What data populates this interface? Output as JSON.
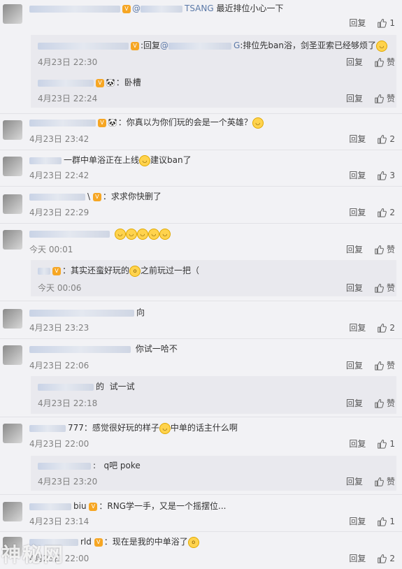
{
  "labels": {
    "reply": "回复",
    "like": "赞"
  },
  "watermark": "神秘网",
  "comments": [
    {
      "id": "c1",
      "text_mention": "@",
      "mention_suffix": "TSANG",
      "text": "最近排位小心一下",
      "time": "",
      "likes": "1"
    },
    {
      "id": "r1",
      "name_suffix": "",
      "text_prefix": ":回复",
      "mention": "@",
      "mention_suffix": "G",
      "text": ":排位先ban浴，剑圣亚索已经够烦了",
      "time": "4月23日 22:30",
      "likes": "赞"
    },
    {
      "id": "r2",
      "text": "：卧槽",
      "time": "4月23日 22:24",
      "likes": "赞"
    },
    {
      "id": "c2",
      "text": "：你真以为你们玩的会是一个英雄？",
      "time": "4月23日 23:42",
      "likes": "2"
    },
    {
      "id": "c3",
      "text_a": "一群中单浴正在上线",
      "text_b": "建议ban了",
      "time": "4月23日 22:42",
      "likes": "3"
    },
    {
      "id": "c4",
      "name_suffix": "\\",
      "text": "：求求你快删了",
      "time": "4月23日 22:29",
      "likes": "2"
    },
    {
      "id": "c5",
      "text": "",
      "time": "今天 00:01",
      "likes": "赞"
    },
    {
      "id": "r3",
      "name_suffix": "浪 9",
      "text_a": "：其实还蛮好玩的",
      "text_b": "之前玩过一把（",
      "time": "今天 00:06",
      "likes": "赞"
    },
    {
      "id": "c6",
      "name_suffix": "向",
      "text": "",
      "time": "4月23日 23:23",
      "likes": "2"
    },
    {
      "id": "c7",
      "text": "你试一哈不",
      "time": "4月23日 22:06",
      "likes": "赞"
    },
    {
      "id": "r4",
      "name_suffix": "的",
      "text": "试一试",
      "time": "4月23日 22:18",
      "likes": "赞"
    },
    {
      "id": "c8",
      "name_suffix": "777",
      "text_a": "：感觉很好玩的样子",
      "text_b": "中单的话主什么啊",
      "time": "4月23日 22:00",
      "likes": "1"
    },
    {
      "id": "r5",
      "name_suffix": ":",
      "text": "q吧  poke",
      "time": "4月23日 23:20",
      "likes": "赞"
    },
    {
      "id": "c9",
      "name_suffix": "biu",
      "text": "：RNG学一手，又是一个摇摆位...",
      "time": "4月23日 23:14",
      "likes": "1"
    },
    {
      "id": "c10",
      "name_suffix": "rld",
      "text_a": "：现在是我的中单浴了",
      "time": "4月23日 22:00",
      "likes": "2"
    }
  ]
}
